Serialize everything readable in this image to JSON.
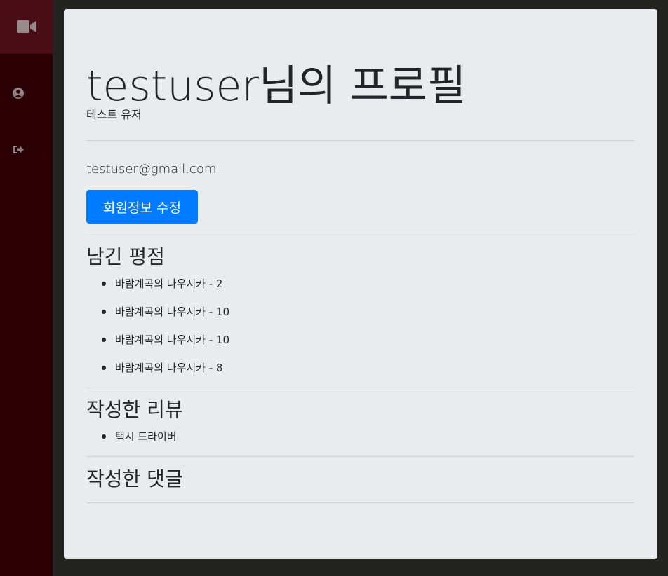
{
  "sidebar": {
    "logo_icon": "video-camera-icon",
    "items": [
      {
        "name": "profile",
        "icon": "user-circle-icon"
      },
      {
        "name": "logout",
        "icon": "sign-out-icon"
      }
    ]
  },
  "profile": {
    "title": "testuser님의 프로필",
    "nickname": "테스트 유저",
    "email": "testuser@gmail.com",
    "edit_button_label": "회원정보 수정"
  },
  "ratings": {
    "heading": "남긴 평점",
    "items": [
      "바람계곡의 나우시카 - 2",
      "바람계곡의 나우시카 - 10",
      "바람계곡의 나우시카 - 10",
      "바람계곡의 나우시카 - 8"
    ]
  },
  "reviews": {
    "heading": "작성한 리뷰",
    "items": [
      "택시 드라이버"
    ]
  },
  "comments": {
    "heading": "작성한 댓글",
    "items": []
  },
  "colors": {
    "sidebar_bg": "#2a0005",
    "sidebar_logo_bg": "#4a0f16",
    "page_bg": "#23241f",
    "card_bg": "#e9ecef",
    "primary": "#007bff"
  }
}
